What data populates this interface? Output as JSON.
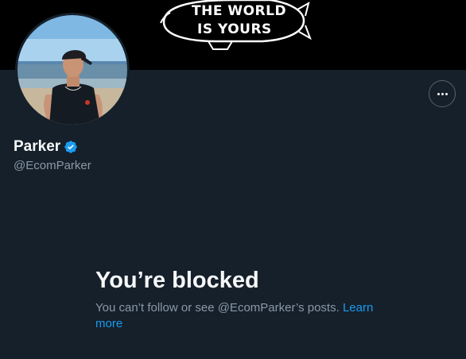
{
  "banner": {
    "line1": "THE WORLD",
    "line2": "IS YOURS"
  },
  "profile": {
    "display_name": "Parker",
    "handle": "@EcomParker",
    "verified": true
  },
  "blocked": {
    "title": "You’re blocked",
    "description": "You can’t follow or see @EcomParker’s posts.",
    "link_label": "Learn more"
  },
  "icons": {
    "more": "more-options-icon",
    "verified": "verified-badge-icon"
  },
  "colors": {
    "background": "#15202b",
    "text_primary": "#f7f9f9",
    "text_secondary": "#8b98a5",
    "accent": "#1d9bf0"
  }
}
